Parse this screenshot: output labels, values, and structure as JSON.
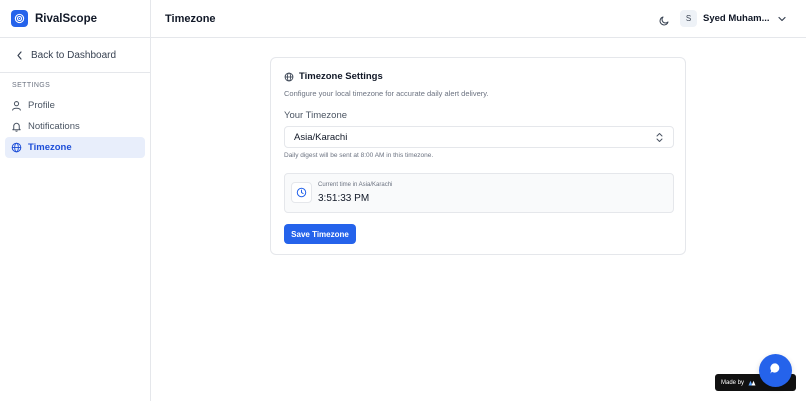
{
  "app": {
    "name": "RivalScope"
  },
  "sidebar": {
    "back_label": "Back to Dashboard",
    "section_label": "SETTINGS",
    "items": [
      {
        "label": "Profile",
        "icon": "user-icon",
        "active": false
      },
      {
        "label": "Notifications",
        "icon": "bell-icon",
        "active": false
      },
      {
        "label": "Timezone",
        "icon": "globe-icon",
        "active": true
      }
    ]
  },
  "header": {
    "title": "Timezone",
    "user": {
      "initial": "S",
      "name": "Syed Muham..."
    }
  },
  "card": {
    "title": "Timezone Settings",
    "description": "Configure your local timezone for accurate daily alert delivery.",
    "field_label": "Your Timezone",
    "selected_timezone": "Asia/Karachi",
    "hint": "Daily digest will be sent at 8:00 AM in this timezone.",
    "current_time_label": "Current time in Asia/Karachi",
    "current_time": "3:51:33 PM",
    "save_label": "Save Timezone"
  },
  "footer": {
    "made_by": "Made by"
  },
  "colors": {
    "accent": "#2563eb",
    "active_bg": "#e8eefb",
    "border": "#e5e7eb",
    "muted": "#6b7280"
  }
}
